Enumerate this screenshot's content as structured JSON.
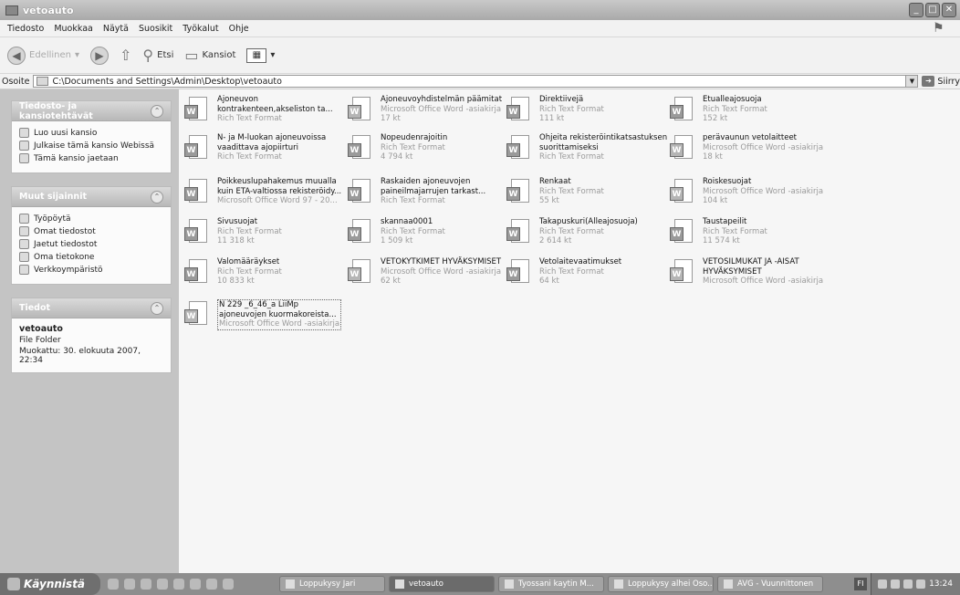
{
  "window": {
    "title": "vetoauto"
  },
  "menu": [
    "Tiedosto",
    "Muokkaa",
    "Näytä",
    "Suosikit",
    "Työkalut",
    "Ohje"
  ],
  "toolbar": {
    "back": "Edellinen",
    "search": "Etsi",
    "folders": "Kansiot"
  },
  "address": {
    "label": "Osoite",
    "path": "C:\\Documents and Settings\\Admin\\Desktop\\vetoauto",
    "go": "Siirry"
  },
  "tasks_panel": {
    "title": "Tiedosto- ja kansiotehtävät",
    "items": [
      "Luo uusi kansio",
      "Julkaise tämä kansio Webissä",
      "Tämä kansio jaetaan"
    ]
  },
  "places_panel": {
    "title": "Muut sijainnit",
    "items": [
      "Työpöytä",
      "Omat tiedostot",
      "Jaetut tiedostot",
      "Oma tietokone",
      "Verkkoympäristö"
    ]
  },
  "details_panel": {
    "title": "Tiedot",
    "name": "vetoauto",
    "kind": "File Folder",
    "modified": "Muokattu: 30. elokuuta 2007, 22:34"
  },
  "files": [
    {
      "name": "Ajoneuvon\nkontrakenteen,akseliston ta...",
      "type": "Rich Text Format",
      "size": "",
      "icon": "rtf"
    },
    {
      "name": "Ajoneuvoyhdistelmän päämitat",
      "type": "Microsoft Office Word -asiakirja",
      "size": "17 kt",
      "icon": "doc"
    },
    {
      "name": "Direktiivejä",
      "type": "Rich Text Format",
      "size": "111 kt",
      "icon": "rtf"
    },
    {
      "name": "Etualleajosuoja",
      "type": "Rich Text Format",
      "size": "152 kt",
      "icon": "rtf"
    },
    {
      "name": "N- ja M-luokan ajoneuvoissa\nvaadittava ajopiirturi",
      "type": "Rich Text Format",
      "size": "",
      "icon": "rtf"
    },
    {
      "name": "Nopeudenrajoitin",
      "type": "Rich Text Format",
      "size": "4 794 kt",
      "icon": "rtf"
    },
    {
      "name": "Ohjeita rekisteröintikatsastuksen\nsuorittamiseksi",
      "type": "Rich Text Format",
      "size": "",
      "icon": "rtf"
    },
    {
      "name": "perävaunun vetolaitteet",
      "type": "Microsoft Office Word -asiakirja",
      "size": "18 kt",
      "icon": "doc"
    },
    {
      "name": "Poikkeuslupahakemus muualla\nkuin ETA-valtiossa rekisteröidy...",
      "type": "Microsoft Office Word 97 - 20...",
      "size": "",
      "icon": "rtf"
    },
    {
      "name": "Raskaiden ajoneuvojen\npaineilmajarrujen tarkast...",
      "type": "Rich Text Format",
      "size": "",
      "icon": "rtf"
    },
    {
      "name": "Renkaat",
      "type": "Rich Text Format",
      "size": "55 kt",
      "icon": "rtf"
    },
    {
      "name": "Roiskesuojat",
      "type": "Microsoft Office Word -asiakirja",
      "size": "104 kt",
      "icon": "doc"
    },
    {
      "name": "Sivusuojat",
      "type": "Rich Text Format",
      "size": "11 318 kt",
      "icon": "rtf"
    },
    {
      "name": "skannaa0001",
      "type": "Rich Text Format",
      "size": "1 509 kt",
      "icon": "rtf"
    },
    {
      "name": "Takapuskuri(Alleajosuoja)",
      "type": "Rich Text Format",
      "size": "2 614 kt",
      "icon": "rtf"
    },
    {
      "name": "Taustapeilit",
      "type": "Rich Text Format",
      "size": "11 574 kt",
      "icon": "rtf"
    },
    {
      "name": "Valomääräykset",
      "type": "Rich Text Format",
      "size": "10 833 kt",
      "icon": "rtf"
    },
    {
      "name": "VETOKYTKIMET HYVÄKSYMISET",
      "type": "Microsoft Office Word -asiakirja",
      "size": "62 kt",
      "icon": "doc"
    },
    {
      "name": "Vetolaitevaatimukset",
      "type": "Rich Text Format",
      "size": "64 kt",
      "icon": "rtf"
    },
    {
      "name": "VETOSILMUKAT JA -AISAT\nHYVÄKSYMISET",
      "type": "Microsoft Office Word -asiakirja",
      "size": "",
      "icon": "doc"
    },
    {
      "name": "N 229 _6_46_a LiiMp\najoneuvojen kuormakoreista...",
      "type": "Microsoft Office Word -asiakirja",
      "size": "",
      "icon": "doc"
    }
  ],
  "taskbar": {
    "start": "Käynnistä",
    "buttons": [
      "Loppukysy Jari",
      "vetoauto",
      "Tyossani kaytin M...",
      "Loppukysy alhei Oso...",
      "AVG - Vuunnittonen"
    ],
    "lang": "FI",
    "clock": "13:24"
  }
}
